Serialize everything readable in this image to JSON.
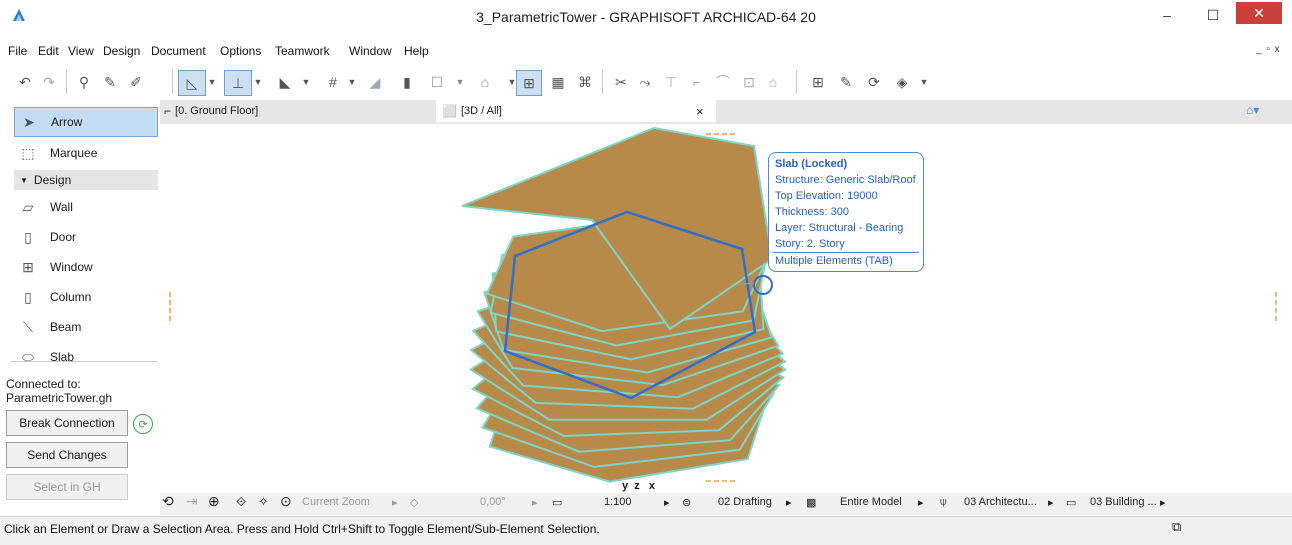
{
  "window": {
    "title": "3_ParametricTower - GRAPHISOFT ARCHICAD-64 20",
    "minimize": "–",
    "maximize": "☐",
    "close": "✕"
  },
  "menu": [
    "File",
    "Edit",
    "View",
    "Design",
    "Document",
    "Options",
    "Teamwork",
    "Window",
    "Help"
  ],
  "mdi_controls": "_ ▫ x",
  "toolbox": {
    "tools": [
      {
        "label": "Arrow",
        "icon": "arrow-icon"
      },
      {
        "label": "Marquee",
        "icon": "marquee-icon"
      }
    ],
    "design_header": "Design",
    "design_tools": [
      {
        "label": "Wall",
        "icon": "wall-icon"
      },
      {
        "label": "Door",
        "icon": "door-icon"
      },
      {
        "label": "Window",
        "icon": "window-icon"
      },
      {
        "label": "Column",
        "icon": "column-icon"
      },
      {
        "label": "Beam",
        "icon": "beam-icon"
      },
      {
        "label": "Slab",
        "icon": "slab-icon"
      }
    ],
    "connected_label": "Connected to:",
    "connected_file": "ParametricTower.gh",
    "break_connection": "Break Connection",
    "send_changes": "Send Changes",
    "select_in_gh": "Select in GH"
  },
  "tabs": [
    {
      "label": "[0. Ground Floor]",
      "icon": "floorplan-icon"
    },
    {
      "label": "[3D / All]",
      "icon": "3d-icon"
    }
  ],
  "tab_close": "×",
  "tooltip": {
    "title": "Slab (Locked)",
    "lines": [
      "Structure: Generic Slab/Roof",
      "Top Elevation: 19000",
      "Thickness: 300",
      "Layer: Structural - Bearing",
      "Story: 2. Story"
    ],
    "footer": "Multiple Elements (TAB)"
  },
  "nav": {
    "zoom_label": "Current Zoom",
    "angle": "0,00°",
    "scale": "1:100",
    "layer_combo": "02 Drafting",
    "model_view": "Entire Model",
    "pen_set": "03 Architectu...",
    "dimension": "03 Building ...",
    "axes": "y  z   x"
  },
  "status": "Click an Element or Draw a Selection Area. Press and Hold Ctrl+Shift to Toggle Element/Sub-Element Selection.",
  "colors": {
    "slab_fill": "#b78a4a",
    "slab_edge": "#7fd4c8",
    "selection": "#2f6fc9",
    "tooltip_text": "#2a5fc0"
  }
}
